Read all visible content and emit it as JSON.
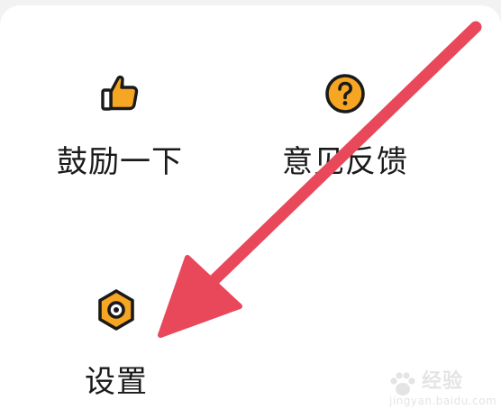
{
  "menu": {
    "items": [
      {
        "label": "鼓励一下",
        "icon": "thumbs-up-icon"
      },
      {
        "label": "意见反馈",
        "icon": "question-icon"
      },
      {
        "label": "设置",
        "icon": "settings-gear-icon"
      }
    ]
  },
  "annotation": {
    "arrow_color": "#e8485a"
  },
  "watermark": {
    "brand_text": "经验",
    "brand_sub": "jingyan.baidu.com"
  },
  "colors": {
    "accent": "#f6a623",
    "icon_stroke": "#1a1a1a",
    "arrow": "#e8485a"
  }
}
